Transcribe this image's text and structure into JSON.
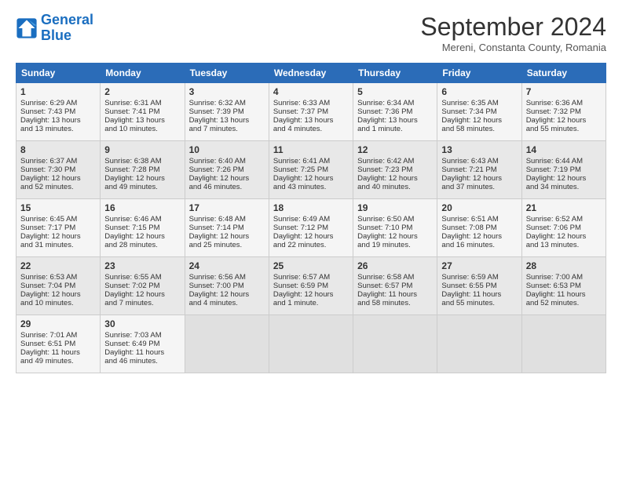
{
  "logo": {
    "line1": "General",
    "line2": "Blue"
  },
  "title": "September 2024",
  "location": "Mereni, Constanta County, Romania",
  "weekdays": [
    "Sunday",
    "Monday",
    "Tuesday",
    "Wednesday",
    "Thursday",
    "Friday",
    "Saturday"
  ],
  "weeks": [
    [
      {
        "day": "1",
        "lines": [
          "Sunrise: 6:29 AM",
          "Sunset: 7:43 PM",
          "Daylight: 13 hours",
          "and 13 minutes."
        ]
      },
      {
        "day": "2",
        "lines": [
          "Sunrise: 6:31 AM",
          "Sunset: 7:41 PM",
          "Daylight: 13 hours",
          "and 10 minutes."
        ]
      },
      {
        "day": "3",
        "lines": [
          "Sunrise: 6:32 AM",
          "Sunset: 7:39 PM",
          "Daylight: 13 hours",
          "and 7 minutes."
        ]
      },
      {
        "day": "4",
        "lines": [
          "Sunrise: 6:33 AM",
          "Sunset: 7:37 PM",
          "Daylight: 13 hours",
          "and 4 minutes."
        ]
      },
      {
        "day": "5",
        "lines": [
          "Sunrise: 6:34 AM",
          "Sunset: 7:36 PM",
          "Daylight: 13 hours",
          "and 1 minute."
        ]
      },
      {
        "day": "6",
        "lines": [
          "Sunrise: 6:35 AM",
          "Sunset: 7:34 PM",
          "Daylight: 12 hours",
          "and 58 minutes."
        ]
      },
      {
        "day": "7",
        "lines": [
          "Sunrise: 6:36 AM",
          "Sunset: 7:32 PM",
          "Daylight: 12 hours",
          "and 55 minutes."
        ]
      }
    ],
    [
      {
        "day": "8",
        "lines": [
          "Sunrise: 6:37 AM",
          "Sunset: 7:30 PM",
          "Daylight: 12 hours",
          "and 52 minutes."
        ]
      },
      {
        "day": "9",
        "lines": [
          "Sunrise: 6:38 AM",
          "Sunset: 7:28 PM",
          "Daylight: 12 hours",
          "and 49 minutes."
        ]
      },
      {
        "day": "10",
        "lines": [
          "Sunrise: 6:40 AM",
          "Sunset: 7:26 PM",
          "Daylight: 12 hours",
          "and 46 minutes."
        ]
      },
      {
        "day": "11",
        "lines": [
          "Sunrise: 6:41 AM",
          "Sunset: 7:25 PM",
          "Daylight: 12 hours",
          "and 43 minutes."
        ]
      },
      {
        "day": "12",
        "lines": [
          "Sunrise: 6:42 AM",
          "Sunset: 7:23 PM",
          "Daylight: 12 hours",
          "and 40 minutes."
        ]
      },
      {
        "day": "13",
        "lines": [
          "Sunrise: 6:43 AM",
          "Sunset: 7:21 PM",
          "Daylight: 12 hours",
          "and 37 minutes."
        ]
      },
      {
        "day": "14",
        "lines": [
          "Sunrise: 6:44 AM",
          "Sunset: 7:19 PM",
          "Daylight: 12 hours",
          "and 34 minutes."
        ]
      }
    ],
    [
      {
        "day": "15",
        "lines": [
          "Sunrise: 6:45 AM",
          "Sunset: 7:17 PM",
          "Daylight: 12 hours",
          "and 31 minutes."
        ]
      },
      {
        "day": "16",
        "lines": [
          "Sunrise: 6:46 AM",
          "Sunset: 7:15 PM",
          "Daylight: 12 hours",
          "and 28 minutes."
        ]
      },
      {
        "day": "17",
        "lines": [
          "Sunrise: 6:48 AM",
          "Sunset: 7:14 PM",
          "Daylight: 12 hours",
          "and 25 minutes."
        ]
      },
      {
        "day": "18",
        "lines": [
          "Sunrise: 6:49 AM",
          "Sunset: 7:12 PM",
          "Daylight: 12 hours",
          "and 22 minutes."
        ]
      },
      {
        "day": "19",
        "lines": [
          "Sunrise: 6:50 AM",
          "Sunset: 7:10 PM",
          "Daylight: 12 hours",
          "and 19 minutes."
        ]
      },
      {
        "day": "20",
        "lines": [
          "Sunrise: 6:51 AM",
          "Sunset: 7:08 PM",
          "Daylight: 12 hours",
          "and 16 minutes."
        ]
      },
      {
        "day": "21",
        "lines": [
          "Sunrise: 6:52 AM",
          "Sunset: 7:06 PM",
          "Daylight: 12 hours",
          "and 13 minutes."
        ]
      }
    ],
    [
      {
        "day": "22",
        "lines": [
          "Sunrise: 6:53 AM",
          "Sunset: 7:04 PM",
          "Daylight: 12 hours",
          "and 10 minutes."
        ]
      },
      {
        "day": "23",
        "lines": [
          "Sunrise: 6:55 AM",
          "Sunset: 7:02 PM",
          "Daylight: 12 hours",
          "and 7 minutes."
        ]
      },
      {
        "day": "24",
        "lines": [
          "Sunrise: 6:56 AM",
          "Sunset: 7:00 PM",
          "Daylight: 12 hours",
          "and 4 minutes."
        ]
      },
      {
        "day": "25",
        "lines": [
          "Sunrise: 6:57 AM",
          "Sunset: 6:59 PM",
          "Daylight: 12 hours",
          "and 1 minute."
        ]
      },
      {
        "day": "26",
        "lines": [
          "Sunrise: 6:58 AM",
          "Sunset: 6:57 PM",
          "Daylight: 11 hours",
          "and 58 minutes."
        ]
      },
      {
        "day": "27",
        "lines": [
          "Sunrise: 6:59 AM",
          "Sunset: 6:55 PM",
          "Daylight: 11 hours",
          "and 55 minutes."
        ]
      },
      {
        "day": "28",
        "lines": [
          "Sunrise: 7:00 AM",
          "Sunset: 6:53 PM",
          "Daylight: 11 hours",
          "and 52 minutes."
        ]
      }
    ],
    [
      {
        "day": "29",
        "lines": [
          "Sunrise: 7:01 AM",
          "Sunset: 6:51 PM",
          "Daylight: 11 hours",
          "and 49 minutes."
        ]
      },
      {
        "day": "30",
        "lines": [
          "Sunrise: 7:03 AM",
          "Sunset: 6:49 PM",
          "Daylight: 11 hours",
          "and 46 minutes."
        ]
      },
      {
        "day": "",
        "lines": []
      },
      {
        "day": "",
        "lines": []
      },
      {
        "day": "",
        "lines": []
      },
      {
        "day": "",
        "lines": []
      },
      {
        "day": "",
        "lines": []
      }
    ]
  ]
}
